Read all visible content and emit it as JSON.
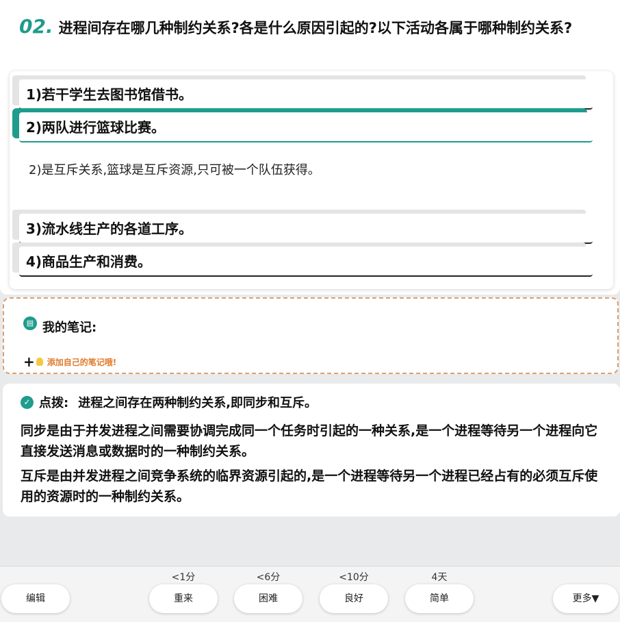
{
  "question": {
    "number": "02.",
    "text": "进程间存在哪几种制约关系?各是什么原因引起的?以下活动各属于哪种制约关系?"
  },
  "options": [
    "1)若干学生去图书馆借书。",
    "2)两队进行篮球比赛。",
    "3)流水线生产的各道工序。",
    "4)商品生产和消费。"
  ],
  "answer": "2)是互斥关系,篮球是互斥资源,只可被一个队伍获得。",
  "notes": {
    "title": "我的笔记:",
    "add_label": "添加自己的笔记哦!"
  },
  "hint": {
    "label": "点拨:",
    "summary": "进程之间存在两种制约关系,即同步和互斥。",
    "paragraphs": [
      "同步是由于并发进程之间需要协调完成同一个任务时引起的一种关系,是一个进程等待另一个进程向它直接发送消息或数据时的一种制约关系。",
      "互斥是由并发进程之间竞争系统的临界资源引起的,是一个进程等待另一个进程已经占有的必须互斥使用的资源时的一种制约关系。"
    ]
  },
  "toolbar": {
    "edit": "编辑",
    "again": "重来",
    "again_time": "<1分",
    "hard": "困难",
    "hard_time": "<6分",
    "good": "良好",
    "good_time": "<10分",
    "easy": "简单",
    "easy_time": "4天",
    "more": "更多▼"
  },
  "colors": {
    "accent": "#1e9c8c",
    "note_border": "#d9a070",
    "note_add": "#e07b2b"
  }
}
